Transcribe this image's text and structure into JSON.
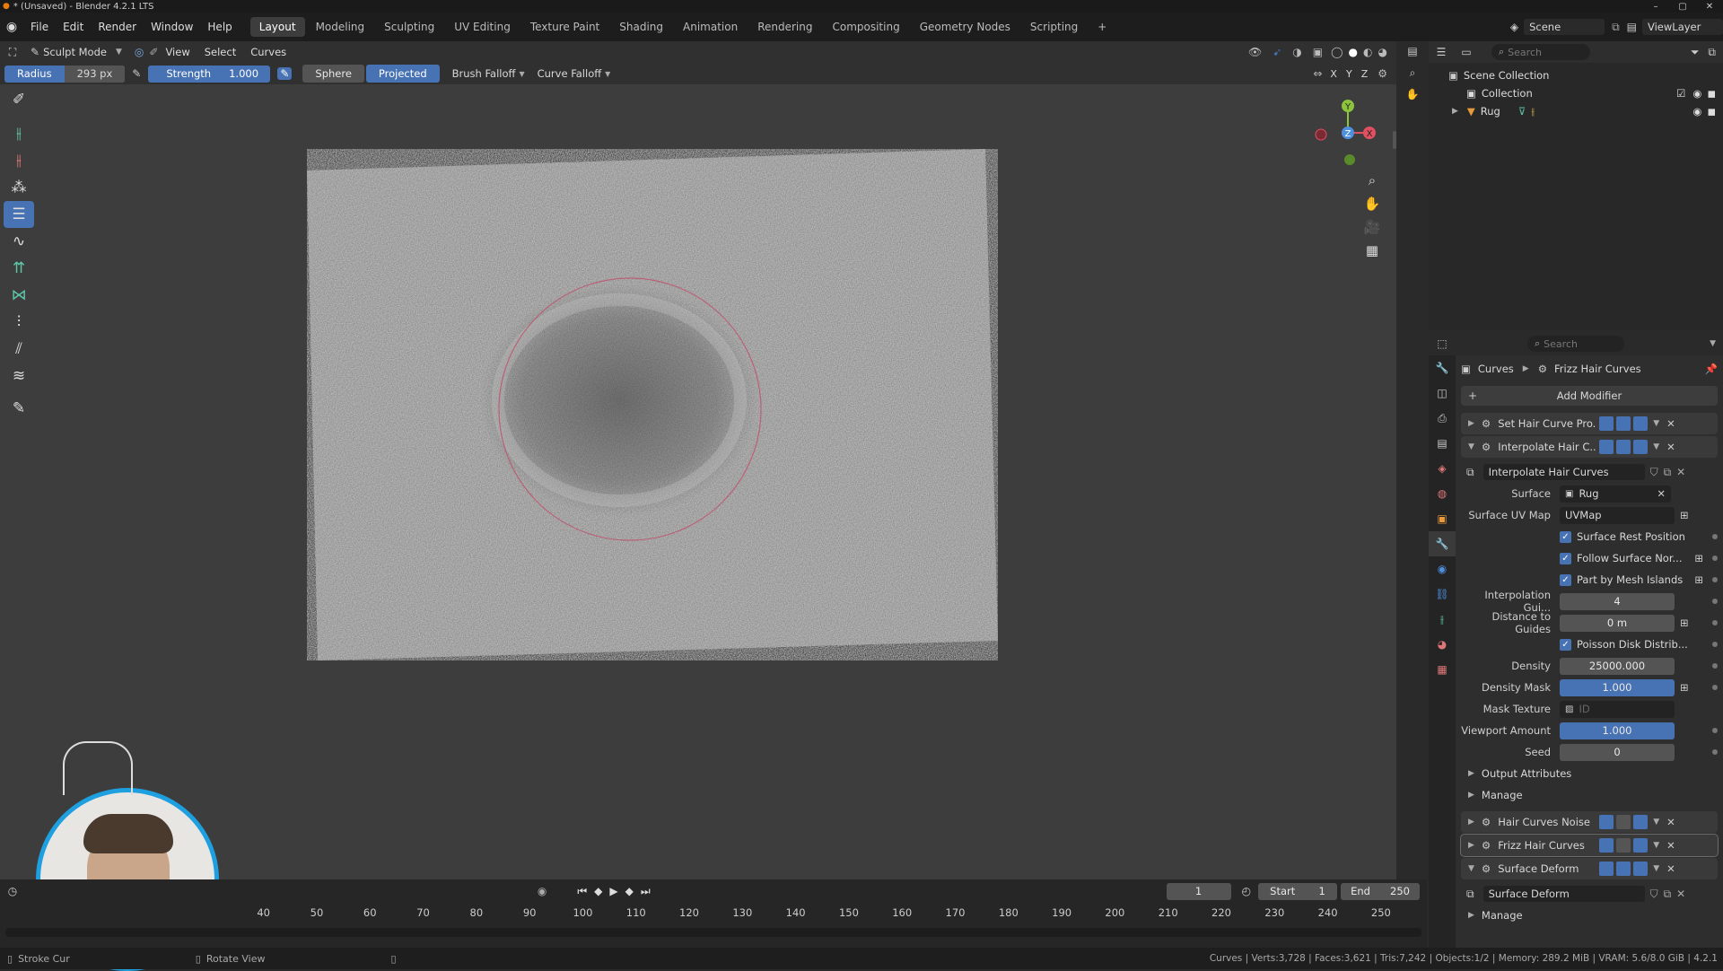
{
  "window": {
    "title": "* (Unsaved) - Blender 4.2.1 LTS"
  },
  "menu": {
    "items": [
      "File",
      "Edit",
      "Render",
      "Window",
      "Help"
    ]
  },
  "workspaces": {
    "tabs": [
      "Layout",
      "Modeling",
      "Sculpting",
      "UV Editing",
      "Texture Paint",
      "Shading",
      "Animation",
      "Rendering",
      "Compositing",
      "Geometry Nodes",
      "Scripting"
    ],
    "active": "Layout",
    "add_label": "+"
  },
  "scene": {
    "label": "Scene",
    "view_layer": "ViewLayer"
  },
  "viewport_header": {
    "mode": "Sculpt Mode",
    "menus": [
      "View",
      "Select",
      "Curves"
    ],
    "axes": [
      "X",
      "Y",
      "Z"
    ]
  },
  "tool_settings": {
    "radius_label": "Radius",
    "radius_value": "293 px",
    "strength_label": "Strength",
    "strength_value": "1.000",
    "sphere_label": "Sphere",
    "projected_label": "Projected",
    "brush_falloff_label": "Brush Falloff",
    "curve_falloff_label": "Curve Falloff"
  },
  "gizmo": {
    "x": "X",
    "y": "Y",
    "z": "Z"
  },
  "outliner": {
    "search_placeholder": "Search",
    "scene_collection": "Scene Collection",
    "collection": "Collection",
    "object": "Rug"
  },
  "properties": {
    "search_placeholder": "Search",
    "breadcrumb_object": "Curves",
    "breadcrumb_modifier": "Frizz Hair Curves",
    "add_modifier_label": "Add Modifier",
    "modifiers": [
      {
        "name": "Set Hair Curve Pro...",
        "expanded": false
      },
      {
        "name": "Interpolate Hair C...",
        "expanded": true
      }
    ],
    "node_group": "Interpolate Hair Curves",
    "fields": {
      "surface_label": "Surface",
      "surface_value": "Rug",
      "uv_map_label": "Surface UV Map",
      "uv_map_value": "UVMap",
      "surface_rest_position": "Surface Rest Position",
      "follow_surface_normal": "Follow Surface Nor...",
      "part_by_mesh_islands": "Part by Mesh Islands",
      "interp_guides_label": "Interpolation Gui...",
      "interp_guides_value": "4",
      "distance_to_guides_label": "Distance to Guides",
      "distance_to_guides_value": "0 m",
      "poisson_disk": "Poisson Disk Distrib...",
      "density_label": "Density",
      "density_value": "25000.000",
      "density_mask_label": "Density Mask",
      "density_mask_value": "1.000",
      "mask_texture_label": "Mask Texture",
      "mask_texture_value": "ID",
      "viewport_amount_label": "Viewport Amount",
      "viewport_amount_value": "1.000",
      "seed_label": "Seed",
      "seed_value": "0"
    },
    "output_attributes_label": "Output Attributes",
    "manage_label": "Manage",
    "lower_modifiers": [
      "Hair Curves Noise",
      "Frizz Hair Curves",
      "Surface Deform"
    ],
    "surface_deform_node": "Surface Deform",
    "manage_label_2": "Manage"
  },
  "timeline": {
    "current_frame": "1",
    "start_label": "Start",
    "start_value": "1",
    "end_label": "End",
    "end_value": "250",
    "ticks": [
      "40",
      "50",
      "60",
      "70",
      "80",
      "90",
      "100",
      "110",
      "120",
      "130",
      "140",
      "150",
      "160",
      "170",
      "180",
      "190",
      "200",
      "210",
      "220",
      "230",
      "240",
      "250"
    ]
  },
  "statusbar": {
    "left_hint": "Stroke Cur",
    "mid_hint": "Rotate View",
    "stats": "Curves | Verts:3,728 | Faces:3,621 | Tris:7,242 | Objects:1/2 | Memory: 289.2 MiB | VRAM: 5.6/8.0 GiB | 4.2.1"
  },
  "colors": {
    "accent": "#4772b3",
    "brush_circle": "#c0506a",
    "bg": "#3d3d3d"
  }
}
